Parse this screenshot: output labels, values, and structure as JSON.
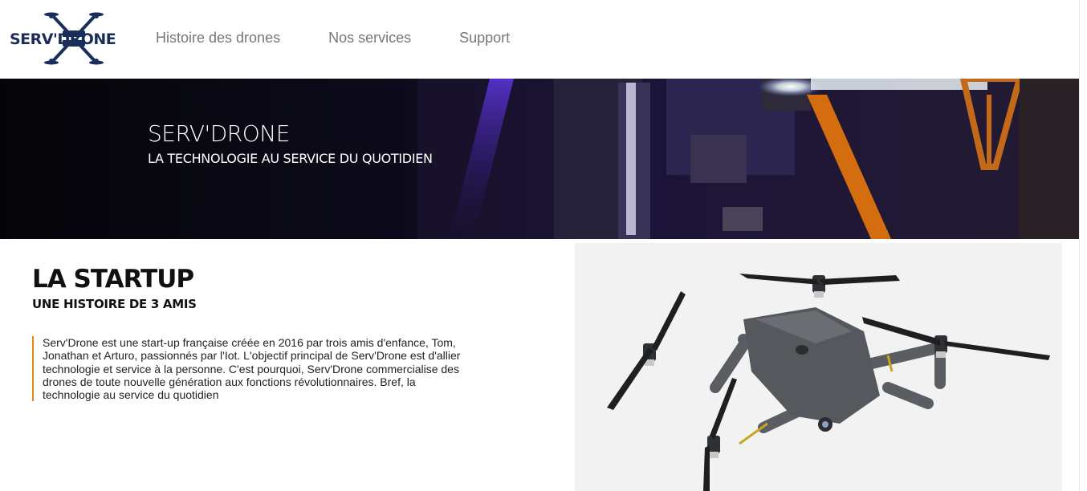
{
  "header": {
    "logo_text": "SERV'DRONE",
    "nav": [
      {
        "label": "Histoire des drones"
      },
      {
        "label": "Nos services"
      },
      {
        "label": "Support"
      }
    ]
  },
  "hero": {
    "title": "SERV'DRONE",
    "subtitle": "LA TECHNOLOGIE AU SERVICE DU QUOTIDIEN"
  },
  "startup": {
    "title": "LA STARTUP",
    "subtitle": "UNE HISTOIRE DE 3 AMIS",
    "body": "Serv'Drone est une start-up française créée en 2016 par trois amis d'enfance, Tom, Jonathan et Arturo, passionnés par l'Iot. L'objectif principal de Serv'Drone est d'allier technologie et service à la personne. C'est pourquoi, Serv'Drone commercialise des drones de toute nouvelle génération aux fonctions révolutionnaires. Bref, la technologie au service du quotidien"
  },
  "colors": {
    "brand_navy": "#1b2e5a",
    "accent_orange": "#e08a10",
    "nav_text": "#777777"
  },
  "icons": {
    "logo": "quadcopter-logo-icon",
    "hero": "drone-hero-image",
    "product": "folding-drone-photo"
  }
}
